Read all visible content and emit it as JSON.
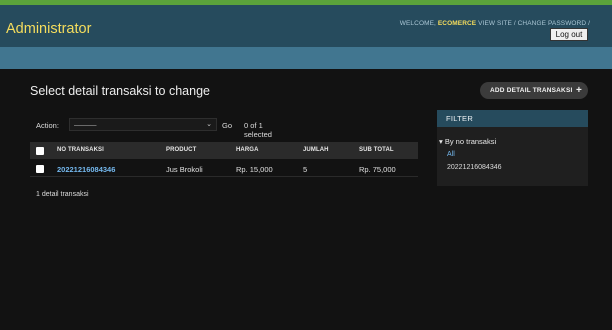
{
  "header": {
    "brand": "Administrator",
    "welcome": "WELCOME,",
    "user": "ECOMERCE",
    "view_site": "VIEW SITE",
    "sep": "/",
    "change_password": "CHANGE PASSWORD",
    "logout": "Log out"
  },
  "content": {
    "title": "Select detail transaksi to change",
    "add_button": "ADD DETAIL TRANSAKSI",
    "add_icon": "+"
  },
  "actions": {
    "label": "Action:",
    "select_value": "———",
    "go": "Go",
    "selected_count": "0 of 1 selected"
  },
  "table": {
    "columns": [
      "NO TRANSAKSI",
      "PRODUCT",
      "HARGA",
      "JUMLAH",
      "SUB TOTAL"
    ],
    "rows": [
      {
        "no_transaksi": "20221216084346",
        "product": "Jus Brokoli",
        "harga": "Rp. 15,000",
        "jumlah": "5",
        "sub_total": "Rp. 75,000"
      }
    ],
    "result_count": "1 detail transaksi"
  },
  "filter": {
    "heading": "FILTER",
    "title": "▾ By no transaksi",
    "all": "All",
    "options": [
      "20221216084346"
    ]
  },
  "colors": {
    "header_bg": "#264b5d",
    "breadcrumb_bg": "#417690",
    "brand": "#f5dd5d",
    "link": "#74b8ee"
  }
}
